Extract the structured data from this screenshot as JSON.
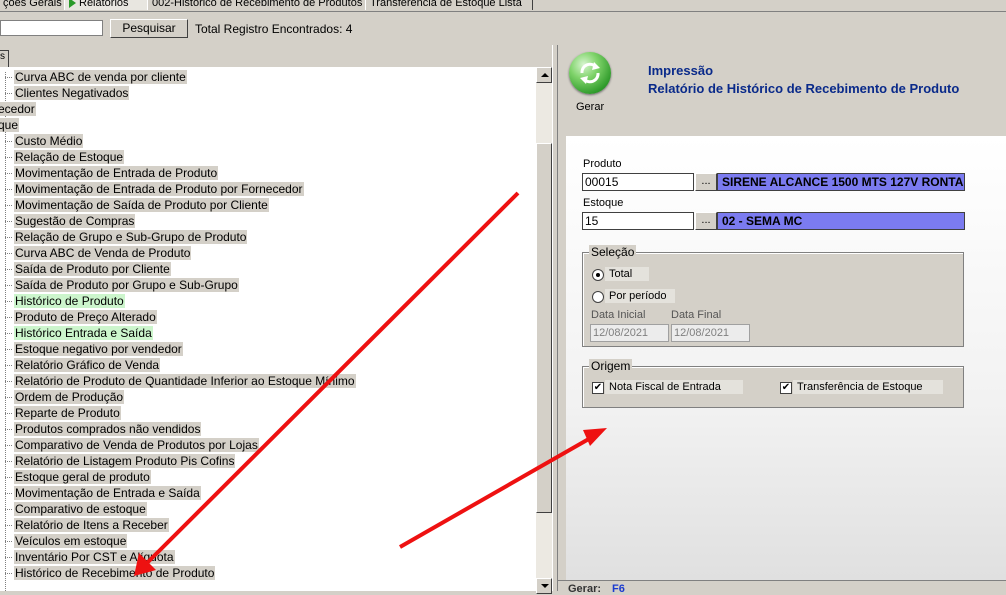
{
  "tabs": [
    "ções Gerais",
    "Relatórios",
    "002-Histórico de Recebimento de Produtos",
    "Transferência de Estoque Lista"
  ],
  "search": {
    "button_label": "Pesquisar",
    "total_text": "Total Registro Encontrados: 4"
  },
  "left_tab_fragment": "s",
  "tree": {
    "groups": [
      "ecedor",
      "que"
    ],
    "items": [
      "Curva ABC de venda por cliente",
      "Clientes Negativados",
      "Custo Médio",
      "Relação de Estoque",
      "Movimentação de Entrada de Produto",
      "Movimentação de Entrada de Produto por Fornecedor",
      "Movimentação de Saída de Produto por Cliente",
      "Sugestão de Compras",
      "Relação de Grupo e Sub-Grupo de Produto",
      "Curva ABC de Venda de Produto",
      "Saída de Produto por Cliente",
      "Saída de Produto por Grupo e Sub-Grupo",
      "Histórico de Produto",
      "Produto de Preço Alterado",
      "Histórico Entrada e Saída",
      "Estoque negativo por vendedor",
      "Relatório Gráfico de Venda",
      "Relatório de Produto de Quantidade Inferior ao Estoque Mínimo",
      "Ordem de Produção",
      "Reparte de Produto",
      "Produtos comprados não vendidos",
      "Comparativo de Venda de Produtos por Lojas",
      "Relatório de Listagem Produto Pis Cofins",
      "Estoque geral de produto",
      "Movimentação de Entrada e Saída",
      "Comparativo de estoque",
      "Relatório de Itens a Receber",
      "Veículos em estoque",
      "Inventário Por CST e Alíquota",
      "Histórico de Recebimento de Produto"
    ]
  },
  "report": {
    "gerar_label": "Gerar",
    "title_line1": "Impressão",
    "title_line2": "Relatório de Histórico de Recebimento de Produto",
    "produto_label": "Produto",
    "produto_code": "00015",
    "produto_desc": "SIRENE ALCANCE 1500 MTS 127V RONTA",
    "estoque_label": "Estoque",
    "estoque_code": "15",
    "estoque_desc": "02 - SEMA MC",
    "lookup_button": "...",
    "selecao_label": "Seleção",
    "opt_total": "Total",
    "opt_periodo": "Por período",
    "data_inicial_label": "Data Inicial",
    "data_final_label": "Data Final",
    "data_inicial": "12/08/2021",
    "data_final": "12/08/2021",
    "origem_label": "Origem",
    "nf_entrada": "Nota Fiscal de Entrada",
    "transf_estoque": "Transferência de Estoque"
  },
  "footer": {
    "label": "Gerar:",
    "key": "F6"
  },
  "colors": {
    "title": "#0a2a8a",
    "desc_bg": "#7b7bf0",
    "highlight": "#ccf5cc",
    "annotation_arrow": "#ee1111"
  }
}
